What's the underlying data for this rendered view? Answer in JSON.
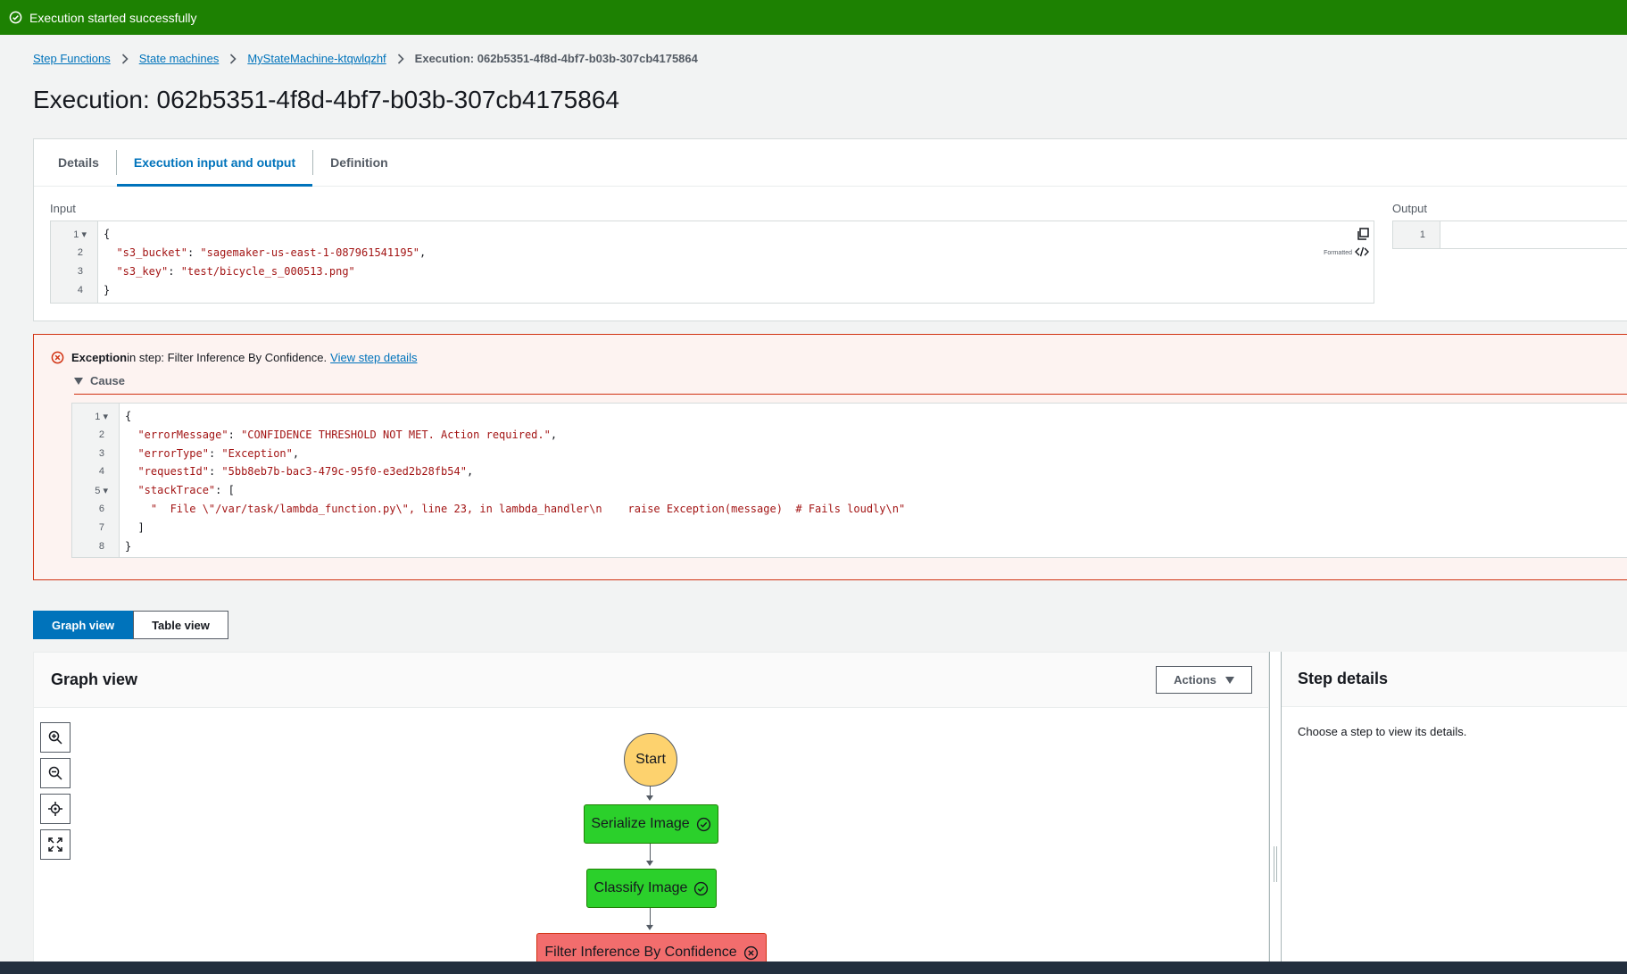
{
  "flash": {
    "message": "Execution started successfully",
    "color": "#1d8102"
  },
  "breadcrumb": [
    {
      "label": "Step Functions"
    },
    {
      "label": "State machines"
    },
    {
      "label": "MyStateMachine-ktqwlqzhf"
    },
    {
      "label": "Execution: 062b5351-4f8d-4bf7-b03b-307cb4175864"
    }
  ],
  "page_title": "Execution: 062b5351-4f8d-4bf7-b03b-307cb4175864",
  "tabs": [
    {
      "label": "Details",
      "active": false
    },
    {
      "label": "Execution input and output",
      "active": true
    },
    {
      "label": "Definition",
      "active": false
    }
  ],
  "input": {
    "label": "Input",
    "formatted_label": "Formatted",
    "lines": [
      {
        "num": "1",
        "fold": "▾",
        "key": "",
        "value": "",
        "text": "{"
      },
      {
        "num": "2",
        "fold": "",
        "key": "\"s3_bucket\"",
        "sep": ": ",
        "value": "\"sagemaker-us-east-1-087961541195\"",
        "tail": ","
      },
      {
        "num": "3",
        "fold": "",
        "key": "\"s3_key\"",
        "sep": ": ",
        "value": "\"test/bicycle_s_000513.png\"",
        "tail": ""
      },
      {
        "num": "4",
        "fold": "",
        "key": "",
        "value": "",
        "text": "}"
      }
    ]
  },
  "output": {
    "label": "Output",
    "lines": [
      {
        "num": "1"
      }
    ]
  },
  "error": {
    "title_bold": "Exception",
    "title_rest": " in step: Filter Inference By Confidence.",
    "link": "View step details",
    "cause_label": "Cause",
    "lines": [
      {
        "num": "1",
        "fold": "▾",
        "text": "{"
      },
      {
        "num": "2",
        "fold": "",
        "key": "\"errorMessage\"",
        "sep": ": ",
        "value": "\"CONFIDENCE THRESHOLD NOT MET. Action required.\"",
        "tail": ","
      },
      {
        "num": "3",
        "fold": "",
        "key": "\"errorType\"",
        "sep": ": ",
        "value": "\"Exception\"",
        "tail": ","
      },
      {
        "num": "4",
        "fold": "",
        "key": "\"requestId\"",
        "sep": ": ",
        "value": "\"5bb8eb7b-bac3-479c-95f0-e3ed2b28fb54\"",
        "tail": ","
      },
      {
        "num": "5",
        "fold": "▾",
        "key": "\"stackTrace\"",
        "sep": ": ",
        "value": "",
        "tail": "["
      },
      {
        "num": "6",
        "fold": "",
        "value": "\"  File \\\"/var/task/lambda_function.py\\\", line 23, in lambda_handler\\n    raise Exception(message)  # Fails loudly\\n\""
      },
      {
        "num": "7",
        "fold": "",
        "text": "]"
      },
      {
        "num": "8",
        "fold": "",
        "text": "}"
      }
    ]
  },
  "view_toggle": [
    {
      "label": "Graph view",
      "active": true
    },
    {
      "label": "Table view",
      "active": false
    }
  ],
  "graph": {
    "title": "Graph view",
    "actions_label": "Actions",
    "nodes": [
      {
        "label": "Start",
        "status": "start"
      },
      {
        "label": "Serialize Image",
        "status": "succeeded"
      },
      {
        "label": "Classify Image",
        "status": "succeeded"
      },
      {
        "label": "Filter Inference By Confidence",
        "status": "failed"
      }
    ]
  },
  "step_details": {
    "title": "Step details",
    "placeholder": "Choose a step to view its details."
  },
  "colors": {
    "accent": "#0073bb",
    "success": "#1d8102",
    "error": "#d13212",
    "node_success": "#2bd02b",
    "node_failed": "#f26d6d",
    "node_start": "#fdd26e"
  }
}
